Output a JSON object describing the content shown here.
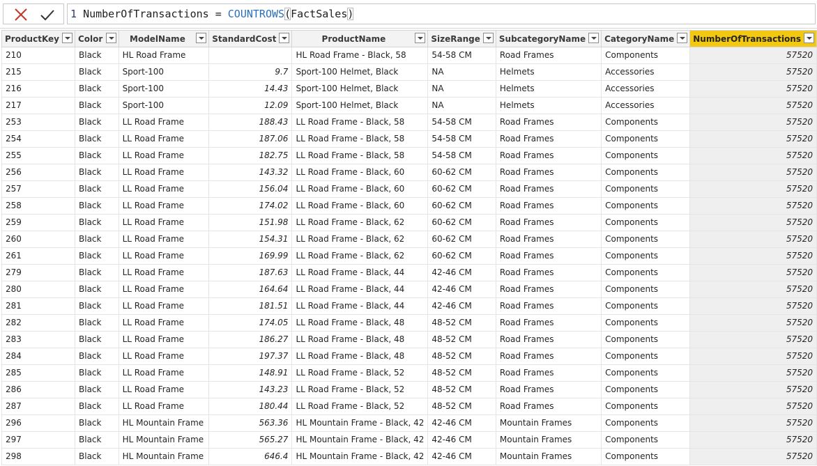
{
  "formula": {
    "line_number": "1",
    "measure_name": "NumberOfTransactions",
    "equals": "=",
    "function": "COUNTROWS",
    "open_paren": "(",
    "argument": "FactSales",
    "close_paren": ")"
  },
  "toolbar": {
    "cancel_icon": "close-x-icon",
    "commit_icon": "checkmark-icon",
    "cancel_color": "#c0392b"
  },
  "accent_color": "#f2c811",
  "columns": [
    "ProductKey",
    "Color",
    "ModelName",
    "StandardCost",
    "ProductName",
    "SizeRange",
    "SubcategoryName",
    "CategoryName",
    "NumberOfTransactions"
  ],
  "rows": [
    [
      "210",
      "Black",
      "HL Road Frame",
      "",
      "HL Road Frame - Black, 58",
      "54-58 CM",
      "Road Frames",
      "Components",
      "57520"
    ],
    [
      "215",
      "Black",
      "Sport-100",
      "9.7",
      "Sport-100 Helmet, Black",
      "NA",
      "Helmets",
      "Accessories",
      "57520"
    ],
    [
      "216",
      "Black",
      "Sport-100",
      "14.43",
      "Sport-100 Helmet, Black",
      "NA",
      "Helmets",
      "Accessories",
      "57520"
    ],
    [
      "217",
      "Black",
      "Sport-100",
      "12.09",
      "Sport-100 Helmet, Black",
      "NA",
      "Helmets",
      "Accessories",
      "57520"
    ],
    [
      "253",
      "Black",
      "LL Road Frame",
      "188.43",
      "LL Road Frame - Black, 58",
      "54-58 CM",
      "Road Frames",
      "Components",
      "57520"
    ],
    [
      "254",
      "Black",
      "LL Road Frame",
      "187.06",
      "LL Road Frame - Black, 58",
      "54-58 CM",
      "Road Frames",
      "Components",
      "57520"
    ],
    [
      "255",
      "Black",
      "LL Road Frame",
      "182.75",
      "LL Road Frame - Black, 58",
      "54-58 CM",
      "Road Frames",
      "Components",
      "57520"
    ],
    [
      "256",
      "Black",
      "LL Road Frame",
      "143.32",
      "LL Road Frame - Black, 60",
      "60-62 CM",
      "Road Frames",
      "Components",
      "57520"
    ],
    [
      "257",
      "Black",
      "LL Road Frame",
      "156.04",
      "LL Road Frame - Black, 60",
      "60-62 CM",
      "Road Frames",
      "Components",
      "57520"
    ],
    [
      "258",
      "Black",
      "LL Road Frame",
      "174.02",
      "LL Road Frame - Black, 60",
      "60-62 CM",
      "Road Frames",
      "Components",
      "57520"
    ],
    [
      "259",
      "Black",
      "LL Road Frame",
      "151.98",
      "LL Road Frame - Black, 62",
      "60-62 CM",
      "Road Frames",
      "Components",
      "57520"
    ],
    [
      "260",
      "Black",
      "LL Road Frame",
      "154.31",
      "LL Road Frame - Black, 62",
      "60-62 CM",
      "Road Frames",
      "Components",
      "57520"
    ],
    [
      "261",
      "Black",
      "LL Road Frame",
      "169.99",
      "LL Road Frame - Black, 62",
      "60-62 CM",
      "Road Frames",
      "Components",
      "57520"
    ],
    [
      "279",
      "Black",
      "LL Road Frame",
      "187.63",
      "LL Road Frame - Black, 44",
      "42-46 CM",
      "Road Frames",
      "Components",
      "57520"
    ],
    [
      "280",
      "Black",
      "LL Road Frame",
      "164.64",
      "LL Road Frame - Black, 44",
      "42-46 CM",
      "Road Frames",
      "Components",
      "57520"
    ],
    [
      "281",
      "Black",
      "LL Road Frame",
      "181.51",
      "LL Road Frame - Black, 44",
      "42-46 CM",
      "Road Frames",
      "Components",
      "57520"
    ],
    [
      "282",
      "Black",
      "LL Road Frame",
      "174.05",
      "LL Road Frame - Black, 48",
      "48-52 CM",
      "Road Frames",
      "Components",
      "57520"
    ],
    [
      "283",
      "Black",
      "LL Road Frame",
      "186.27",
      "LL Road Frame - Black, 48",
      "48-52 CM",
      "Road Frames",
      "Components",
      "57520"
    ],
    [
      "284",
      "Black",
      "LL Road Frame",
      "197.37",
      "LL Road Frame - Black, 48",
      "48-52 CM",
      "Road Frames",
      "Components",
      "57520"
    ],
    [
      "285",
      "Black",
      "LL Road Frame",
      "148.91",
      "LL Road Frame - Black, 52",
      "48-52 CM",
      "Road Frames",
      "Components",
      "57520"
    ],
    [
      "286",
      "Black",
      "LL Road Frame",
      "143.23",
      "LL Road Frame - Black, 52",
      "48-52 CM",
      "Road Frames",
      "Components",
      "57520"
    ],
    [
      "287",
      "Black",
      "LL Road Frame",
      "180.44",
      "LL Road Frame - Black, 52",
      "48-52 CM",
      "Road Frames",
      "Components",
      "57520"
    ],
    [
      "296",
      "Black",
      "HL Mountain Frame",
      "563.36",
      "HL Mountain Frame - Black, 42",
      "42-46 CM",
      "Mountain Frames",
      "Components",
      "57520"
    ],
    [
      "297",
      "Black",
      "HL Mountain Frame",
      "565.27",
      "HL Mountain Frame - Black, 42",
      "42-46 CM",
      "Mountain Frames",
      "Components",
      "57520"
    ],
    [
      "298",
      "Black",
      "HL Mountain Frame",
      "646.4",
      "HL Mountain Frame - Black, 42",
      "42-46 CM",
      "Mountain Frames",
      "Components",
      "57520"
    ]
  ]
}
